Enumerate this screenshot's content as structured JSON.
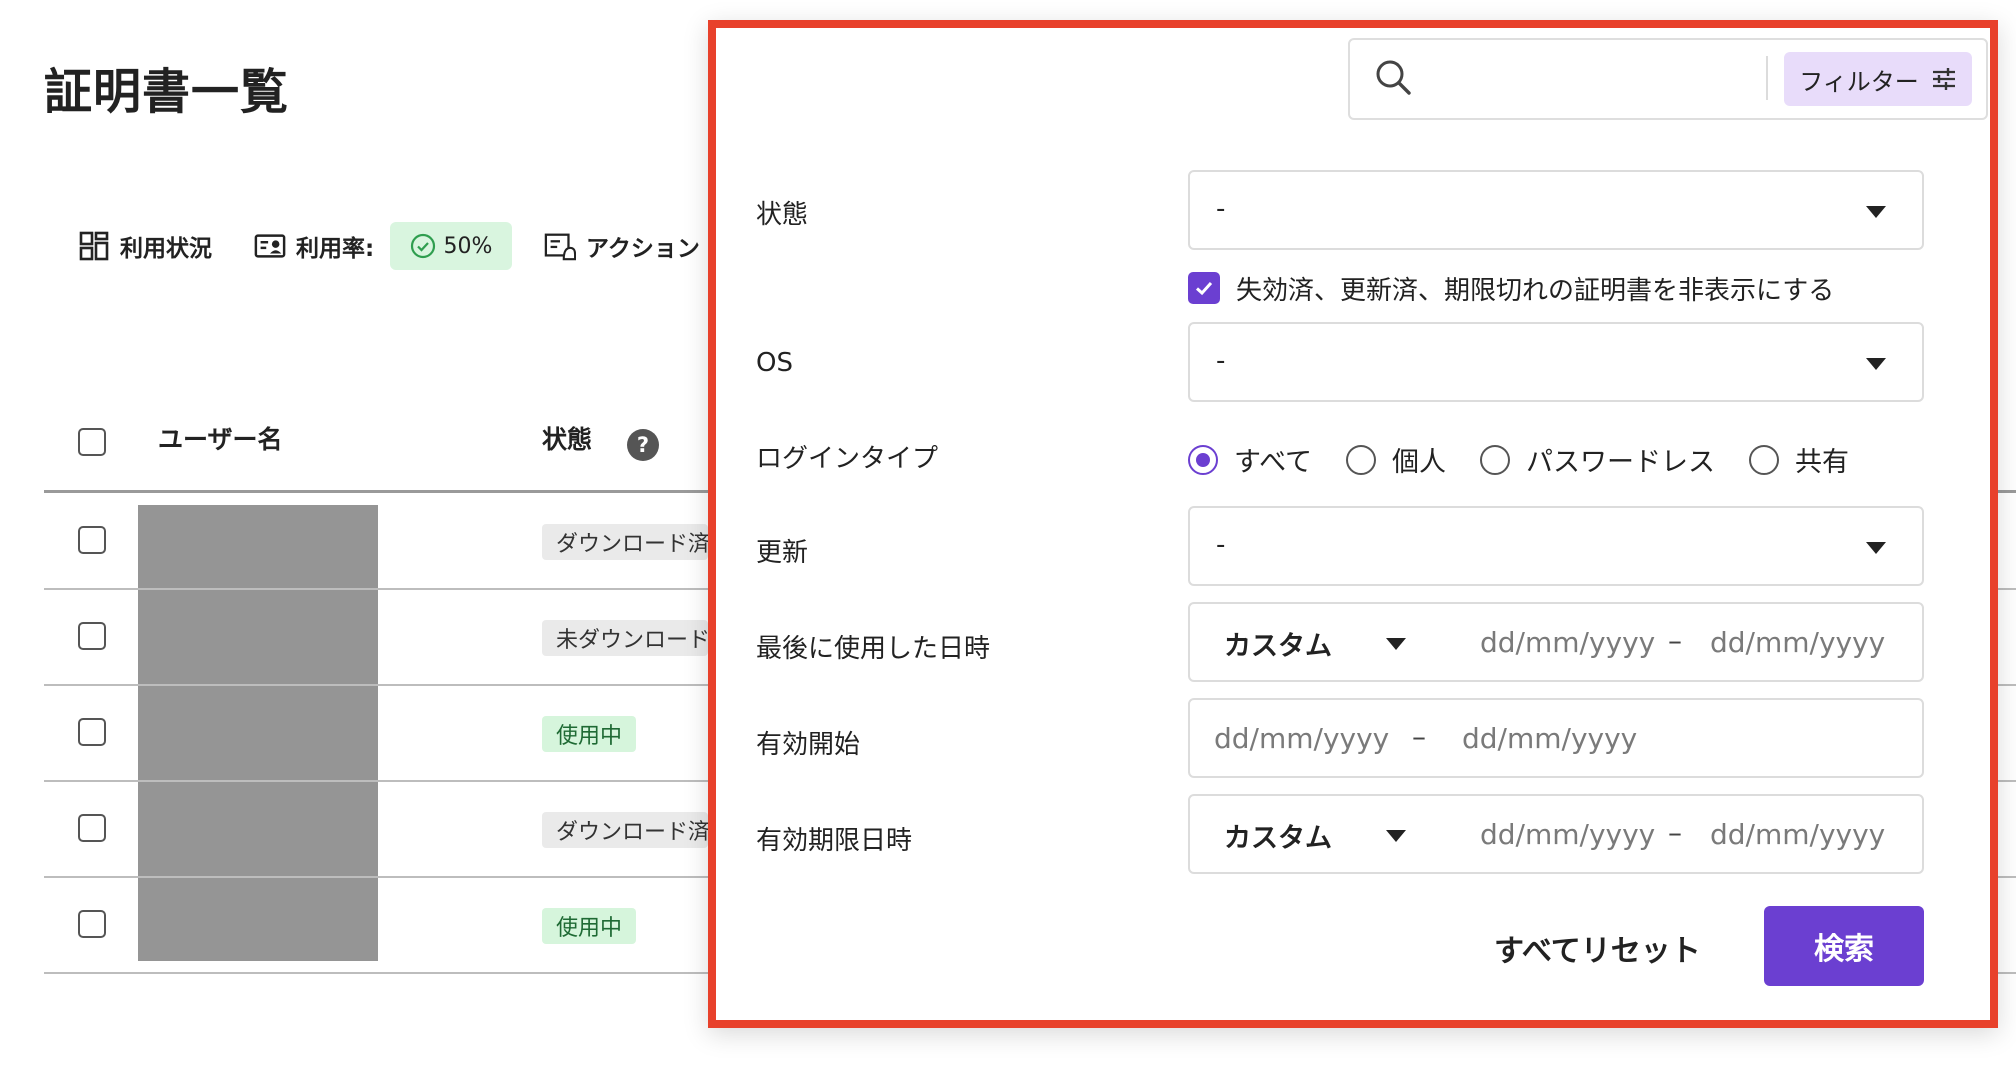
{
  "page": {
    "title": "証明書一覧",
    "toolbar": {
      "usage_label": "利用状況",
      "rate_label": "利用率:",
      "rate_value": "50%",
      "actions_label": "アクション"
    },
    "table": {
      "col_user": "ユーザー名",
      "col_state": "状態",
      "rows": [
        {
          "state": "ダウンロード済",
          "state_color": "#eaeaea"
        },
        {
          "state": "未ダウンロード",
          "state_color": "#eaeaea"
        },
        {
          "state": "使用中",
          "state_color": "#d6f5dc"
        },
        {
          "state": "ダウンロード済",
          "state_color": "#eaeaea"
        },
        {
          "state": "使用中",
          "state_color": "#d6f5dc"
        }
      ]
    }
  },
  "panel": {
    "search": {
      "value": "",
      "placeholder": ""
    },
    "filter_button": "フィルター",
    "fields": {
      "state": {
        "label": "状態",
        "value": "-"
      },
      "hide_expired": {
        "label": "失効済、更新済、期限切れの証明書を非表示にする",
        "checked": true
      },
      "os": {
        "label": "OS",
        "value": "-"
      },
      "login_type": {
        "label": "ログインタイプ",
        "options": [
          "すべて",
          "個人",
          "パスワードレス",
          "共有"
        ],
        "selected": "すべて"
      },
      "renewal": {
        "label": "更新",
        "value": "-"
      },
      "last_used": {
        "label": "最後に使用した日時",
        "mode": "カスタム",
        "from": "dd/mm/yyyy",
        "sep": "–",
        "to": "dd/mm/yyyy"
      },
      "valid_start": {
        "label": "有効開始",
        "from": "dd/mm/yyyy",
        "sep": "–",
        "to": "dd/mm/yyyy"
      },
      "valid_end": {
        "label": "有効期限日時",
        "mode": "カスタム",
        "from": "dd/mm/yyyy",
        "sep": "–",
        "to": "dd/mm/yyyy"
      }
    },
    "reset_label": "すべてリセット",
    "search_button": "検索"
  },
  "colors": {
    "accent": "#6b3fd1",
    "highlight_border": "#e8412b",
    "rate_badge": "#d9f5df",
    "filter_button_bg": "#e8dcfa"
  },
  "icons": [
    "grid-icon",
    "id-card-icon",
    "check-circle-icon",
    "action-list-icon",
    "help-icon",
    "search-icon",
    "sliders-icon",
    "chevron-down-icon",
    "checkmark-icon"
  ]
}
